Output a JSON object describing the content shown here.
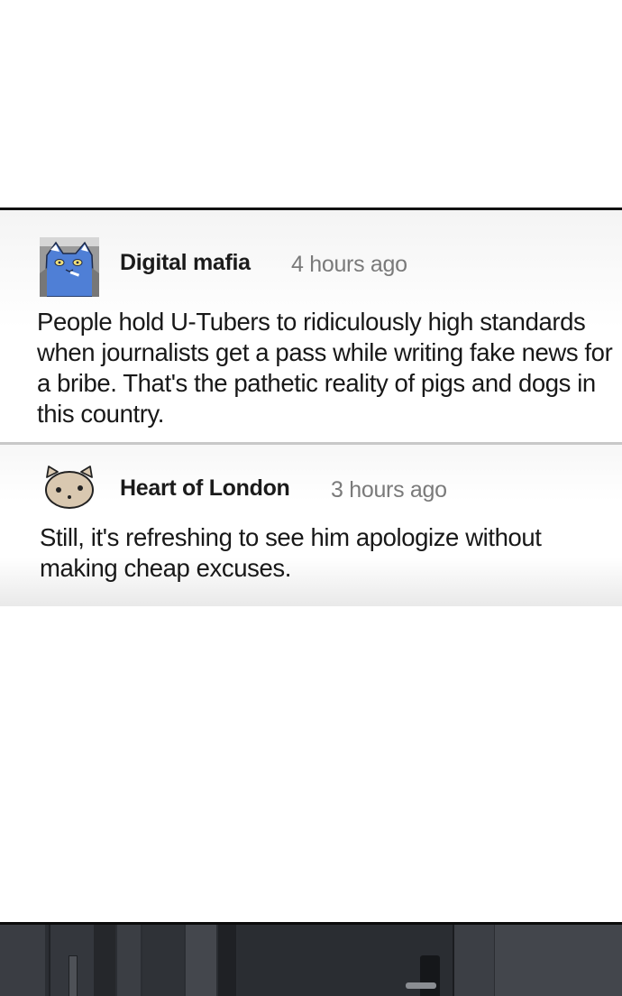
{
  "comments": [
    {
      "username": "Digital mafia",
      "timestamp": "4 hours ago",
      "avatar_icon": "blue-cat-avatar-icon",
      "text": "People hold U-Tubers to ridiculously high standards when journalists get a pass while writing fake news for a bribe. That's the pathetic reality of pigs and dogs in this country."
    },
    {
      "username": "Heart of London",
      "timestamp": "3 hours ago",
      "avatar_icon": "beige-cat-face-avatar-icon",
      "text": "Still, it's refreshing to see him apologize without making cheap excuses."
    }
  ],
  "colors": {
    "username": "#1b1b1b",
    "timestamp": "#7a7a7a",
    "panel_border": "#111111",
    "divider": "#c8c8c8"
  }
}
